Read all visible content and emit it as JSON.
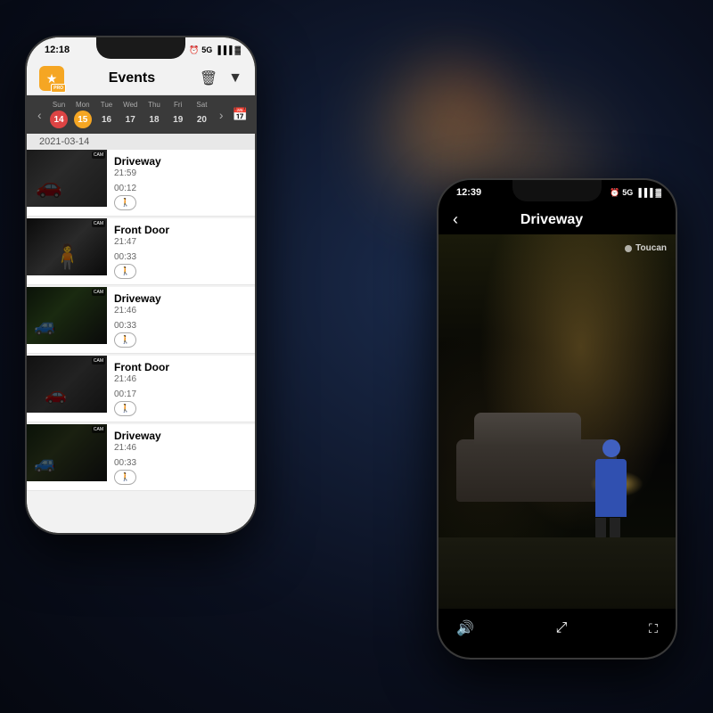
{
  "background": {
    "description": "Dark night bokeh background"
  },
  "phone_left": {
    "status_bar": {
      "time": "12:18",
      "icons": "⏰ 5G ▐ 🔋"
    },
    "header": {
      "title": "Events",
      "delete_icon": "🗑",
      "filter_icon": "▼"
    },
    "calendar": {
      "days": [
        {
          "name": "Sun",
          "num": "14",
          "state": "prev"
        },
        {
          "name": "Mon",
          "num": "15",
          "state": "today"
        },
        {
          "name": "Tue",
          "num": "16",
          "state": "normal"
        },
        {
          "name": "Wed",
          "num": "17",
          "state": "normal"
        },
        {
          "name": "Thu",
          "num": "18",
          "state": "normal"
        },
        {
          "name": "Fri",
          "num": "19",
          "state": "normal"
        },
        {
          "name": "Sat",
          "num": "20",
          "state": "normal"
        }
      ]
    },
    "date_label": "2021-03-14",
    "events": [
      {
        "location": "Driveway",
        "time": "21:59",
        "duration": "00:12",
        "badge": "motion"
      },
      {
        "location": "Front Door",
        "time": "21:47",
        "duration": "00:33",
        "badge": "motion"
      },
      {
        "location": "Driveway",
        "time": "21:46",
        "duration": "00:33",
        "badge": "motion"
      },
      {
        "location": "Front Door",
        "time": "21:46",
        "duration": "00:17",
        "badge": "motion"
      },
      {
        "location": "Driveway",
        "time": "21:46",
        "duration": "00:33",
        "badge": "motion"
      }
    ]
  },
  "phone_right": {
    "status_bar": {
      "time": "12:39",
      "icons": "⏰ 5G ▐ 🔋"
    },
    "header": {
      "back_label": "‹",
      "title": "Driveway"
    },
    "watermark": "Toucan",
    "controls": {
      "volume_icon": "volume",
      "fullscreen_icon": "fullscreen",
      "expand_icon": "expand"
    }
  }
}
